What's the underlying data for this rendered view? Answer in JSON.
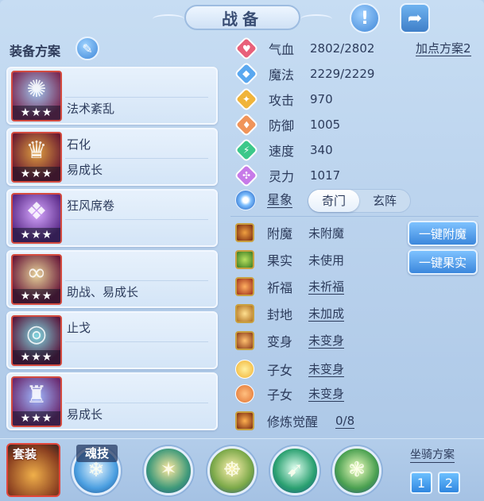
{
  "header": {
    "title": "战备",
    "info_icon": "exclamation-icon",
    "share_icon": "share-icon"
  },
  "equip": {
    "title": "装备方案",
    "edit_icon": "pencil-icon",
    "stars": "★★★",
    "items": [
      {
        "line1": "",
        "line2": "法术紊乱",
        "icon": "fan-weapon-icon",
        "color1": "#9fc7ef",
        "color2": "#7a2a55"
      },
      {
        "line1": "石化",
        "line2": "易成长",
        "icon": "helmet-icon",
        "color1": "#e0a040",
        "color2": "#6a1a30"
      },
      {
        "line1": "狂风席卷",
        "line2": "",
        "icon": "armor-icon",
        "color1": "#d7a8ff",
        "color2": "#5a2a88"
      },
      {
        "line1": "",
        "line2": "助战、易成长",
        "icon": "necklace-icon",
        "color1": "#e6d39a",
        "color2": "#6a1a3a"
      },
      {
        "line1": "止戈",
        "line2": "",
        "icon": "belt-icon",
        "color1": "#7fd7e0",
        "color2": "#5a1a40"
      },
      {
        "line1": "",
        "line2": "易成长",
        "icon": "boots-icon",
        "color1": "#9fb9ff",
        "color2": "#6a2a70"
      }
    ]
  },
  "stats": {
    "plan_link": "加点方案2",
    "rows": [
      {
        "label": "气血",
        "value": "2802/2802",
        "icon": "heart-icon",
        "color": "#e8607a"
      },
      {
        "label": "魔法",
        "value": "2229/2229",
        "icon": "mana-icon",
        "color": "#5aa8f0"
      },
      {
        "label": "攻击",
        "value": "970",
        "icon": "sword-icon",
        "color": "#f0b43a"
      },
      {
        "label": "防御",
        "value": "1005",
        "icon": "shield-icon",
        "color": "#f0945a"
      },
      {
        "label": "速度",
        "value": "340",
        "icon": "speed-icon",
        "color": "#3cc88a"
      },
      {
        "label": "灵力",
        "value": "1017",
        "icon": "spirit-icon",
        "color": "#c77ae8"
      }
    ]
  },
  "star_image": {
    "label": "星象",
    "icon": "star-compass-icon",
    "options": [
      "奇门",
      "玄阵"
    ],
    "selected": "奇门"
  },
  "buffs": [
    {
      "label": "附魔",
      "value": "未附魔",
      "underline": false,
      "icon": "enchant-icon",
      "c1": "#f0a040",
      "c2": "#7a2a10",
      "round": false
    },
    {
      "label": "果实",
      "value": "未使用",
      "underline": false,
      "icon": "fruit-icon",
      "c1": "#b8e060",
      "c2": "#3a7a20",
      "round": false
    },
    {
      "label": "祈福",
      "value": "未祈福",
      "underline": true,
      "icon": "blessing-icon",
      "c1": "#ffb060",
      "c2": "#a0301a",
      "round": false
    },
    {
      "label": "封地",
      "value": "未加成",
      "underline": true,
      "icon": "scroll-icon",
      "c1": "#ffe090",
      "c2": "#b07020",
      "round": false
    },
    {
      "label": "变身",
      "value": "未变身",
      "underline": true,
      "icon": "transform-icon",
      "c1": "#ffc070",
      "c2": "#8a3a18",
      "round": false
    },
    {
      "label": "子女",
      "value": "未变身",
      "underline": true,
      "icon": "child-sun-icon",
      "c1": "#fff0a0",
      "c2": "#f0b030",
      "round": true
    },
    {
      "label": "子女",
      "value": "未变身",
      "underline": true,
      "icon": "child-fire-icon",
      "c1": "#ffc080",
      "c2": "#e07030",
      "round": true
    },
    {
      "label": "修炼觉醒",
      "value": "0/8",
      "underline": true,
      "icon": "cultivation-icon",
      "c1": "#ffb050",
      "c2": "#7a2a10",
      "round": false
    }
  ],
  "actions": {
    "enchant_all": "一键附魔",
    "fruit_all": "一键果实"
  },
  "bottom": {
    "suit_label": "套装",
    "soul_skill_label": "魂技",
    "orbs": [
      {
        "icon": "soul-skill-icon",
        "c1": "#e8f6ff",
        "c2": "#4a9ee0"
      },
      {
        "icon": "warrior-skill-icon",
        "c1": "#ffe9a0",
        "c2": "#3f9a7a"
      },
      {
        "icon": "monk-skill-icon",
        "c1": "#fff2b0",
        "c2": "#7aa848"
      },
      {
        "icon": "slash-skill-icon",
        "c1": "#e0fff0",
        "c2": "#2aa070"
      },
      {
        "icon": "crystal-skill-icon",
        "c1": "#f0ffc0",
        "c2": "#4aa050"
      }
    ],
    "mount_title": "坐骑方案",
    "mount_buttons": [
      "1",
      "2"
    ]
  }
}
